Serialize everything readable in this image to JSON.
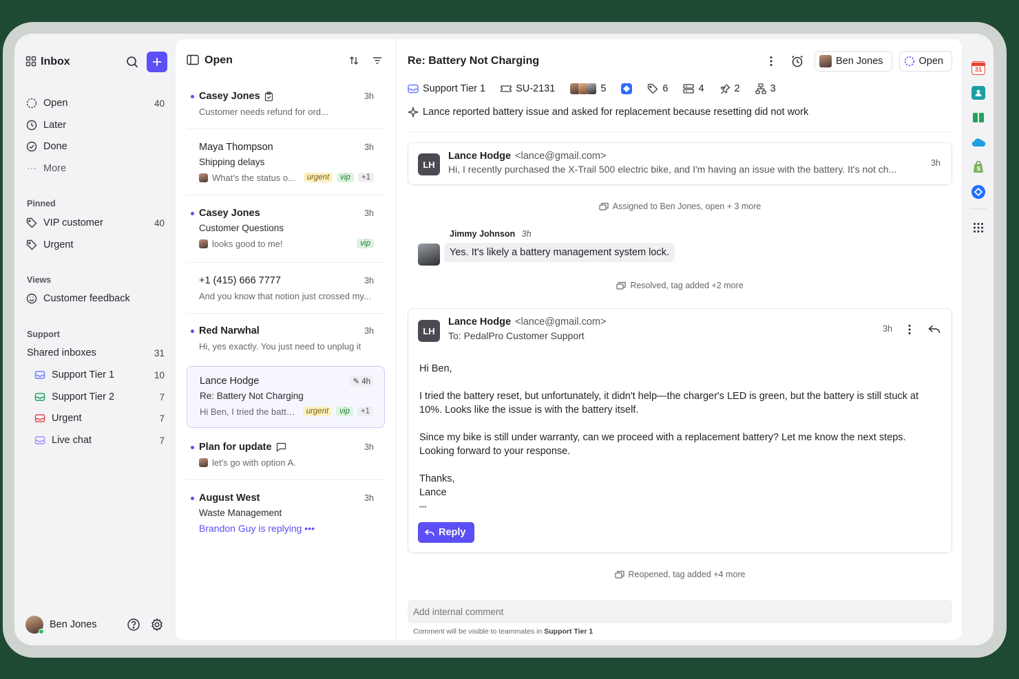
{
  "sidebar": {
    "title": "Inbox",
    "items": [
      {
        "label": "Open",
        "count": "40"
      },
      {
        "label": "Later",
        "count": ""
      },
      {
        "label": "Done",
        "count": ""
      },
      {
        "label": "More",
        "count": ""
      }
    ],
    "pinned_header": "Pinned",
    "pinned": [
      {
        "label": "VIP customer",
        "count": "40"
      },
      {
        "label": "Urgent",
        "count": ""
      }
    ],
    "views_header": "Views",
    "views": [
      {
        "label": "Customer feedback"
      }
    ],
    "support_header": "Support",
    "shared": {
      "label": "Shared inboxes",
      "count": "31"
    },
    "inboxes": [
      {
        "label": "Support Tier 1",
        "count": "10",
        "color": "#6b7cff"
      },
      {
        "label": "Support Tier 2",
        "count": "7",
        "color": "#22a45d"
      },
      {
        "label": "Urgent",
        "count": "7",
        "color": "#e5484d"
      },
      {
        "label": "Live chat",
        "count": "7",
        "color": "#a78bfa"
      }
    ],
    "user": "Ben Jones"
  },
  "list": {
    "title": "Open",
    "conversations": [
      {
        "name": "Casey Jones",
        "time": "3h",
        "preview": "Customer needs refund for ord..."
      },
      {
        "name": "Maya Thompson",
        "time": "3h",
        "subject": "Shipping delays",
        "preview": "What's the status o...",
        "tags": [
          "urgent",
          "vip",
          "+1"
        ]
      },
      {
        "name": "Casey Jones",
        "time": "3h",
        "subject": "Customer Questions",
        "preview": "looks good to me!",
        "tags": [
          "vip"
        ]
      },
      {
        "name": "+1 (415) 666 7777",
        "time": "3h",
        "preview": "And you know that notion just crossed my..."
      },
      {
        "name": "Red Narwhal",
        "time": "3h",
        "preview": "Hi, yes exactly. You just need to unplug it"
      },
      {
        "name": "Lance Hodge",
        "time": "4h",
        "subject": "Re: Battery Not Charging",
        "preview": "Hi Ben, I tried the batte...",
        "tags": [
          "urgent",
          "vip",
          "+1"
        ]
      },
      {
        "name": "Plan for update",
        "time": "3h",
        "preview": "let's go with option A."
      },
      {
        "name": "August West",
        "time": "3h",
        "subject": "Waste Management",
        "preview": "Brandon Guy is replying"
      }
    ]
  },
  "thread": {
    "subject": "Re: Battery Not Charging",
    "assignee": "Ben Jones",
    "status": "Open",
    "meta": {
      "inbox": "Support Tier 1",
      "ticket": "SU-2131",
      "participants": "5",
      "tags": "6",
      "b": "4",
      "pins": "2",
      "links": "3"
    },
    "summary": "Lance reported battery issue and asked for replacement because resetting did not work",
    "msg1": {
      "initials": "LH",
      "name": "Lance Hodge",
      "email": "<lance@gmail.com>",
      "time": "3h",
      "preview": "Hi, I recently purchased the X-Trail 500 electric bike, and I'm having an issue with the battery. It's not ch..."
    },
    "event1": "Assigned to Ben Jones, open + 3 more",
    "comment": {
      "name": "Jimmy Johnson",
      "time": "3h",
      "text": "Yes. It's likely a battery management system lock."
    },
    "event2": "Resolved, tag added +2 more",
    "msg2": {
      "initials": "LH",
      "name": "Lance Hodge",
      "email": "<lance@gmail.com>",
      "to": "To: PedalPro Customer Support",
      "time": "3h",
      "p1": "Hi Ben,",
      "p2": "I tried the battery reset, but unfortunately, it didn't help—the charger's LED is green, but the battery is still stuck at 10%. Looks like the issue is with the battery itself.",
      "p3": "Since my bike is still under warranty, can we proceed with a replacement battery? Let me know the next steps. Looking forward to your response.",
      "p4a": "Thanks,",
      "p4b": "Lance",
      "ellipsis": "•••",
      "reply": "Reply"
    },
    "event3": "Reopened, tag added +4 more",
    "comment_placeholder": "Add internal comment",
    "hint_prefix": "Comment will be visible to teammates in",
    "hint_inbox": "Support Tier 1"
  },
  "rail": {
    "calendar_day": "31"
  }
}
